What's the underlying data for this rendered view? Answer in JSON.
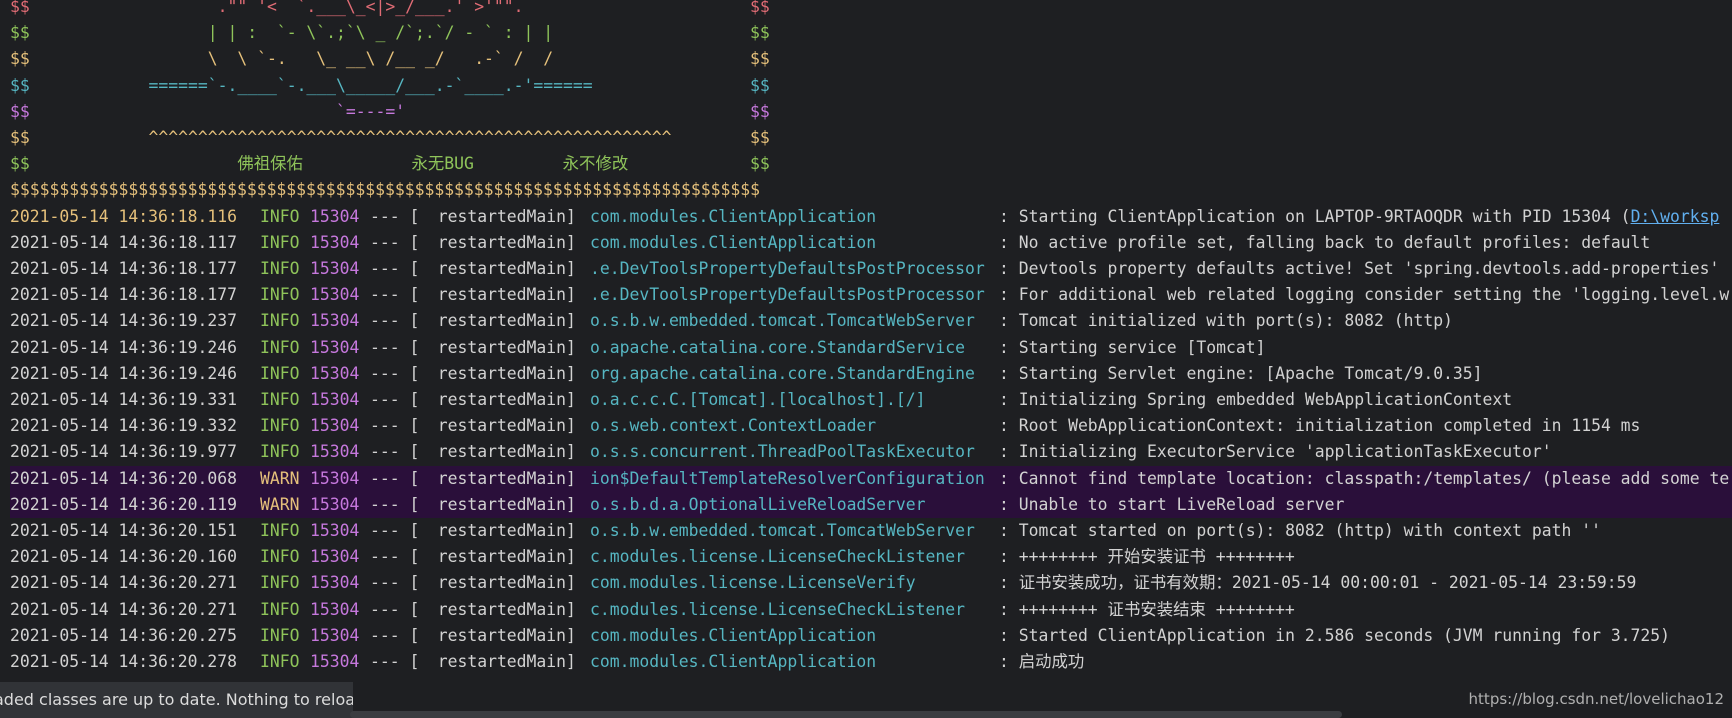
{
  "banner": [
    {
      "left": "$$",
      "right": "$$",
      "art": "                  .\"\" '<  `.___\\_<|>_/___.' >'\"\".                   ",
      "art_color": "#e06c75",
      "side_color": "#e06c75",
      "art_col": 0
    },
    {
      "left": "$$",
      "right": "$$",
      "art": "                 | | :  `- \\`.;`\\ _ /`;.`/ - ` : | |                   ",
      "art_color": "#8fc45a",
      "side_color": "#8fc45a",
      "art_col": 0
    },
    {
      "left": "$$",
      "right": "$$",
      "art": "                 \\  \\ `-.   \\_ __\\ /__ _/   .-` /  /                   ",
      "art_color": "#e5c07b",
      "side_color": "#e5c07b",
      "art_col": 0
    },
    {
      "left": "$$",
      "right": "$$",
      "art": "           ======`-.____`-.___\\_____/___.-`____.-'======              ",
      "art_color": "#56b6c2",
      "side_color": "#56b6c2",
      "art_col": 0
    },
    {
      "left": "$$",
      "right": "$$",
      "art": "                              `=---='                                 ",
      "art_color": "#c678dd",
      "side_color": "#c678dd",
      "art_col": 0
    },
    {
      "left": "$$",
      "right": "$$",
      "art": "           ^^^^^^^^^^^^^^^^^^^^^^^^^^^^^^^^^^^^^^^^^^^^^^^^^^^^^       ",
      "art_color": "#e5c07b",
      "side_color": "#e5c07b",
      "art_col": 0
    },
    {
      "left": "$$",
      "right": "$$",
      "art": "                    佛祖保佑           永无BUG         永不修改           ",
      "art_color": "#8fc45a",
      "side_color": "#8fc45a",
      "art_col": 0
    }
  ],
  "dollar_line": "$$$$$$$$$$$$$$$$$$$$$$$$$$$$$$$$$$$$$$$$$$$$$$$$$$$$$$$$$$$$$$$$$$$$$$$$$$$$",
  "dollar_color": "#e5c07b",
  "logs": [
    {
      "ts": "2021-05-14 14:36:18.116",
      "level": "INFO",
      "pid": "15304",
      "sep": "--- [",
      "thread": "  restartedMain]",
      "logger": "com.modules.ClientApplication",
      "msg": ": Starting ClientApplication on LAPTOP-9RTAOQDR with PID 15304 (",
      "link": "D:\\worksp"
    },
    {
      "ts": "2021-05-14 14:36:18.117",
      "level": "INFO",
      "pid": "15304",
      "sep": "--- [",
      "thread": "  restartedMain]",
      "logger": "com.modules.ClientApplication",
      "msg": ": No active profile set, falling back to default profiles: default",
      "link": ""
    },
    {
      "ts": "2021-05-14 14:36:18.177",
      "level": "INFO",
      "pid": "15304",
      "sep": "--- [",
      "thread": "  restartedMain]",
      "logger": ".e.DevToolsPropertyDefaultsPostProcessor",
      "msg": ": Devtools property defaults active! Set 'spring.devtools.add-properties'",
      "link": ""
    },
    {
      "ts": "2021-05-14 14:36:18.177",
      "level": "INFO",
      "pid": "15304",
      "sep": "--- [",
      "thread": "  restartedMain]",
      "logger": ".e.DevToolsPropertyDefaultsPostProcessor",
      "msg": ": For additional web related logging consider setting the 'logging.level.w",
      "link": ""
    },
    {
      "ts": "2021-05-14 14:36:19.237",
      "level": "INFO",
      "pid": "15304",
      "sep": "--- [",
      "thread": "  restartedMain]",
      "logger": "o.s.b.w.embedded.tomcat.TomcatWebServer",
      "msg": ": Tomcat initialized with port(s): 8082 (http)",
      "link": ""
    },
    {
      "ts": "2021-05-14 14:36:19.246",
      "level": "INFO",
      "pid": "15304",
      "sep": "--- [",
      "thread": "  restartedMain]",
      "logger": "o.apache.catalina.core.StandardService",
      "msg": ": Starting service [Tomcat]",
      "link": ""
    },
    {
      "ts": "2021-05-14 14:36:19.246",
      "level": "INFO",
      "pid": "15304",
      "sep": "--- [",
      "thread": "  restartedMain]",
      "logger": "org.apache.catalina.core.StandardEngine",
      "msg": ": Starting Servlet engine: [Apache Tomcat/9.0.35]",
      "link": ""
    },
    {
      "ts": "2021-05-14 14:36:19.331",
      "level": "INFO",
      "pid": "15304",
      "sep": "--- [",
      "thread": "  restartedMain]",
      "logger": "o.a.c.c.C.[Tomcat].[localhost].[/]",
      "msg": ": Initializing Spring embedded WebApplicationContext",
      "link": ""
    },
    {
      "ts": "2021-05-14 14:36:19.332",
      "level": "INFO",
      "pid": "15304",
      "sep": "--- [",
      "thread": "  restartedMain]",
      "logger": "o.s.web.context.ContextLoader",
      "msg": ": Root WebApplicationContext: initialization completed in 1154 ms",
      "link": ""
    },
    {
      "ts": "2021-05-14 14:36:19.977",
      "level": "INFO",
      "pid": "15304",
      "sep": "--- [",
      "thread": "  restartedMain]",
      "logger": "o.s.s.concurrent.ThreadPoolTaskExecutor",
      "msg": ": Initializing ExecutorService 'applicationTaskExecutor'",
      "link": ""
    },
    {
      "ts": "2021-05-14 14:36:20.068",
      "level": "WARN",
      "pid": "15304",
      "sep": "--- [",
      "thread": "  restartedMain]",
      "logger": "ion$DefaultTemplateResolverConfiguration",
      "msg": ": Cannot find template location: classpath:/templates/ (please add some te",
      "link": ""
    },
    {
      "ts": "2021-05-14 14:36:20.119",
      "level": "WARN",
      "pid": "15304",
      "sep": "--- [",
      "thread": "  restartedMain]",
      "logger": "o.s.b.d.a.OptionalLiveReloadServer",
      "msg": ": Unable to start LiveReload server",
      "link": ""
    },
    {
      "ts": "2021-05-14 14:36:20.151",
      "level": "INFO",
      "pid": "15304",
      "sep": "--- [",
      "thread": "  restartedMain]",
      "logger": "o.s.b.w.embedded.tomcat.TomcatWebServer",
      "msg": ": Tomcat started on port(s): 8082 (http) with context path ''",
      "link": ""
    },
    {
      "ts": "2021-05-14 14:36:20.160",
      "level": "INFO",
      "pid": "15304",
      "sep": "--- [",
      "thread": "  restartedMain]",
      "logger": "c.modules.license.LicenseCheckListener",
      "msg": ": ++++++++ 开始安装证书 ++++++++",
      "link": ""
    },
    {
      "ts": "2021-05-14 14:36:20.271",
      "level": "INFO",
      "pid": "15304",
      "sep": "--- [",
      "thread": "  restartedMain]",
      "logger": "com.modules.license.LicenseVerify",
      "msg": ": 证书安装成功，证书有效期：2021-05-14 00:00:01 - 2021-05-14 23:59:59",
      "link": ""
    },
    {
      "ts": "2021-05-14 14:36:20.271",
      "level": "INFO",
      "pid": "15304",
      "sep": "--- [",
      "thread": "  restartedMain]",
      "logger": "c.modules.license.LicenseCheckListener",
      "msg": ": ++++++++ 证书安装结束 ++++++++",
      "link": ""
    },
    {
      "ts": "2021-05-14 14:36:20.275",
      "level": "INFO",
      "pid": "15304",
      "sep": "--- [",
      "thread": "  restartedMain]",
      "logger": "com.modules.ClientApplication",
      "msg": ": Started ClientApplication in 2.586 seconds (JVM running for 3.725)",
      "link": ""
    },
    {
      "ts": "2021-05-14 14:36:20.278",
      "level": "INFO",
      "pid": "15304",
      "sep": "--- [",
      "thread": "  restartedMain]",
      "logger": "com.modules.ClientApplication",
      "msg": ": 启动成功",
      "link": ""
    }
  ],
  "status": {
    "toast": "aded classes are up to date. Nothing to reload.",
    "watermark": "https://blog.csdn.net/lovelichao12"
  },
  "colors": {
    "background": "#1e1f22",
    "info": "#8fc45a",
    "warn": "#e5c07b",
    "pid": "#c678dd",
    "logger": "#56b6c2",
    "warn_row_bg": "#2a0f3a"
  }
}
